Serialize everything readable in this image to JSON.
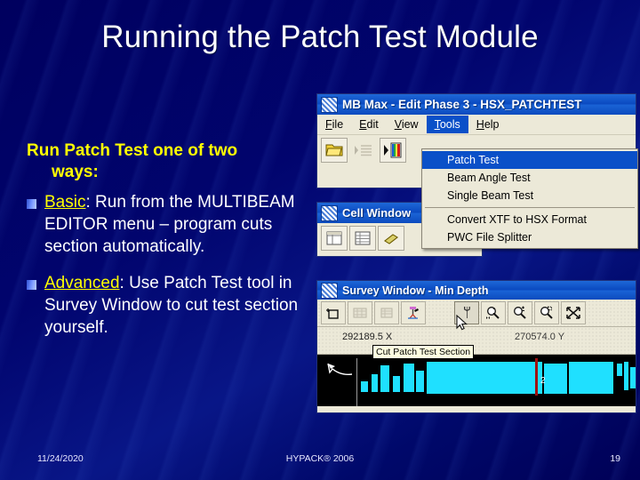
{
  "slide": {
    "title": "Running the Patch Test Module",
    "lead_line1": "Run Patch Test one of two",
    "lead_line2": "ways:",
    "bullets": [
      {
        "keyword": "Basic",
        "text": ": Run from the MULTIBEAM EDITOR menu – program cuts section automatically."
      },
      {
        "keyword": "Advanced",
        "text": ": Use Patch Test tool in Survey Window to cut test section yourself."
      }
    ]
  },
  "footer": {
    "date": "11/24/2020",
    "center": "HYPACK® 2006",
    "page": "19"
  },
  "mbmax": {
    "title": "MB Max - Edit Phase 3 - HSX_PATCHTEST",
    "menu": [
      "File",
      "Edit",
      "View",
      "Tools",
      "Help"
    ],
    "active_menu": "Tools",
    "toolbar_icons": [
      "open-folder-icon",
      "list-disabled-icon",
      "run-color-icon"
    ]
  },
  "tools_menu": {
    "items": [
      {
        "label": "Patch Test",
        "selected": true
      },
      {
        "label": "Beam Angle Test",
        "selected": false
      },
      {
        "label": "Single Beam Test",
        "selected": false
      },
      {
        "separator": true
      },
      {
        "label": "Convert XTF to HSX Format",
        "selected": false
      },
      {
        "label": "PWC File Splitter",
        "selected": false
      }
    ]
  },
  "cellwindow": {
    "title": "Cell Window",
    "toolbar_icons": [
      "table-columns-icon",
      "table-rows-icon",
      "eraser-icon"
    ]
  },
  "survey": {
    "title": "Survey Window - Min Depth",
    "toolbar_left": [
      "new-section-icon",
      "grid-disabled-icon",
      "list-disabled-icon",
      "surveyor-icon"
    ],
    "toolbar_right": [
      "wrench-icon",
      "zoom-vertical-icon",
      "zoom-inout-icon",
      "zoom-window-icon",
      "expand-icon"
    ],
    "coord_x": "292189.5 X",
    "coord_y": "270574.0 Y",
    "tooltip": "Cut Patch Test Section",
    "marker_label": "2"
  },
  "colors": {
    "background": "#00006b",
    "title_text": "#ffffff",
    "lead_text": "#ffff00",
    "body_text": "#ffffff",
    "keyword": "#ffff00",
    "titlebar": "#0a49c0",
    "menu_highlight": "#0a50c8",
    "plot_data": "#1fe0ff",
    "plot_marker": "#a01010"
  }
}
